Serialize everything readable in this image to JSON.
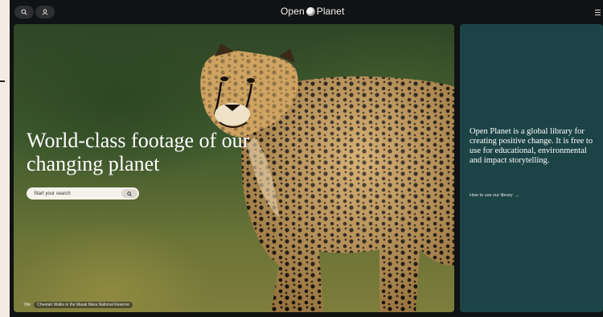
{
  "header": {
    "logo_text_left": "Open",
    "logo_text_right": "Planet",
    "icons": [
      "search-icon",
      "user-icon",
      "menu-icon"
    ]
  },
  "hero": {
    "title": "World-class footage of our changing planet",
    "search": {
      "placeholder": "Start your search"
    },
    "caption": {
      "label": "Title",
      "value": "Cheetah Walks in the Masai Mara National Reserve"
    }
  },
  "info": {
    "text": "Open Planet is a global library for creating positive change. It is free to use for educational, environmental and impact storytelling.",
    "link": "How to use our library",
    "link_arrow": "→"
  },
  "colors": {
    "page_bg": "#f4ece4",
    "frame_bg": "#111213",
    "panel_bg": "#1c4446"
  }
}
